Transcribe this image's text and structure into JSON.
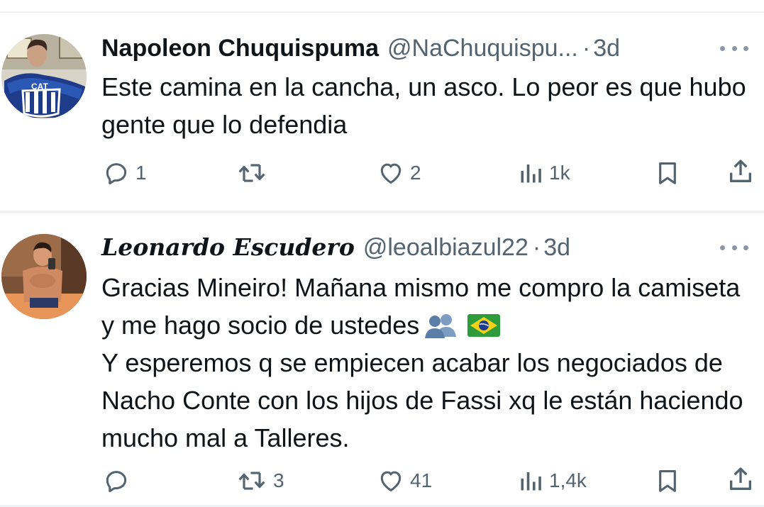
{
  "tweets": [
    {
      "display_name": "Napoleon Chuquispuma",
      "handle": "@NaChuquispu...",
      "separator": "·",
      "time": "3d",
      "text": "Este camina en la cancha, un asco. Lo peor es que hubo gente que lo defendia",
      "actions": {
        "reply_count": "1",
        "retweet_count": "",
        "like_count": "2",
        "view_count": "1k"
      }
    },
    {
      "display_name": "Leonardo Escudero",
      "handle": "@leoalbiazul22",
      "separator": "·",
      "time": "3d",
      "text_line1": "Gracias Mineiro! Mañana mismo me compro la camiseta y me hago socio de ustedes",
      "emojis": [
        "busts-in-silhouette-icon",
        "brazil-flag-icon"
      ],
      "text_line2": "Y esperemos q se empiecen acabar los negociados de Nacho Conte con los hijos de Fassi xq le están haciendo mucho mal a Talleres.",
      "actions": {
        "reply_count": "",
        "retweet_count": "3",
        "like_count": "41",
        "view_count": "1,4k"
      }
    }
  ],
  "colors": {
    "text": "#0f1419",
    "secondary": "#536471",
    "divider": "#eef1f3",
    "flag_green": "#2e9c3a",
    "flag_yellow": "#f7d117",
    "flag_blue": "#1b3d8f",
    "people_blue": "#5b7ea8"
  },
  "icons": [
    "reply-icon",
    "retweet-icon",
    "like-icon",
    "views-icon",
    "bookmark-icon",
    "share-icon",
    "more-icon"
  ]
}
